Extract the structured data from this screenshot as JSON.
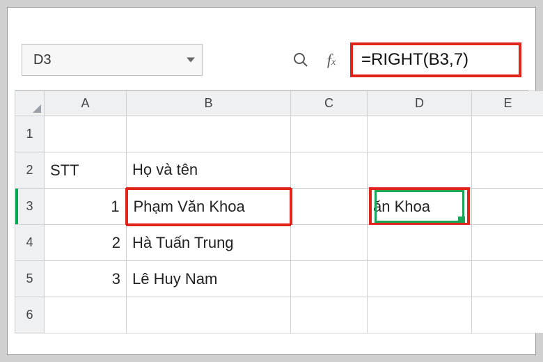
{
  "namebox": {
    "value": "D3"
  },
  "formula": {
    "value": "=RIGHT(B3,7)"
  },
  "columns": [
    "A",
    "B",
    "C",
    "D",
    "E"
  ],
  "rows": [
    {
      "n": "1",
      "A": "",
      "B": "",
      "C": "",
      "D": "",
      "E": ""
    },
    {
      "n": "2",
      "A": "STT",
      "B": "Họ và tên",
      "C": "",
      "D": "",
      "E": ""
    },
    {
      "n": "3",
      "A": "1",
      "B": "Phạm Văn Khoa",
      "C": "",
      "D": "ăn Khoa",
      "E": ""
    },
    {
      "n": "4",
      "A": "2",
      "B": "Hà Tuấn Trung",
      "C": "",
      "D": "",
      "E": ""
    },
    {
      "n": "5",
      "A": "3",
      "B": "Lê Huy Nam",
      "C": "",
      "D": "",
      "E": ""
    },
    {
      "n": "6",
      "A": "",
      "B": "",
      "C": "",
      "D": "",
      "E": ""
    }
  ]
}
